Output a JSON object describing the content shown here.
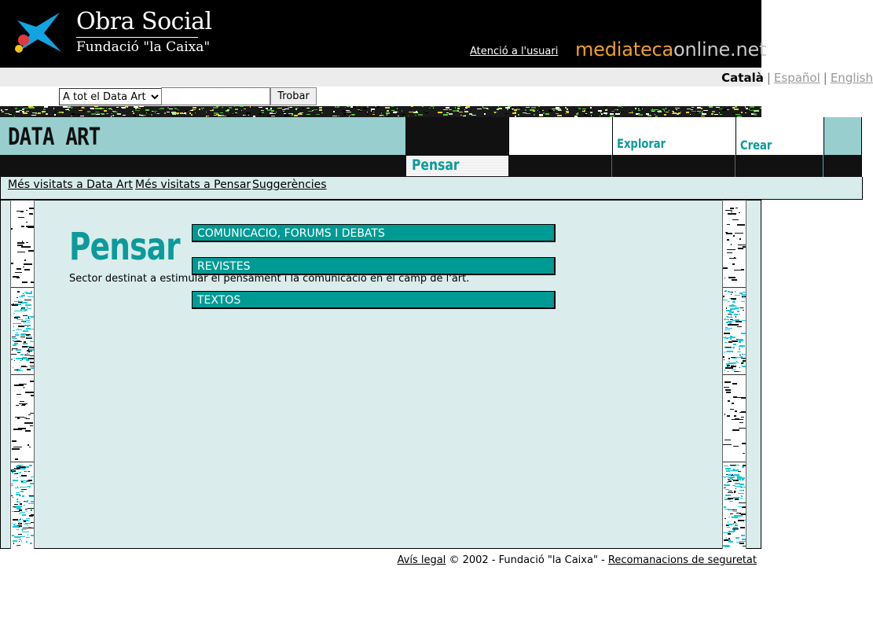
{
  "header": {
    "brand_title": "Obra Social",
    "brand_subtitle": "Fundació \"la Caixa\"",
    "user_link": "Atenció a l'usuari",
    "site_name_part1": "mediateca",
    "site_name_part2": "online.net"
  },
  "languages": {
    "catala": "Català",
    "espanol": "Español",
    "english": "English",
    "separator": "|"
  },
  "search": {
    "scope_selected": "A tot el Data Art",
    "input_value": "",
    "button_label": "Trobar"
  },
  "nav": {
    "section_title": "DATA ART",
    "tabs": [
      {
        "label": "Pensar",
        "active": true
      },
      {
        "label": "Explorar",
        "active": false
      },
      {
        "label": "Crear",
        "active": false
      }
    ]
  },
  "links_bar": {
    "links": [
      "Més visitats a Data Art",
      "Més visitats a Pensar",
      "Suggerències"
    ]
  },
  "main": {
    "heading": "Pensar",
    "description": "Sector destinat a estimular el pensament i la comunicació en el camp de l'art.",
    "sections": [
      "COMUNICACIO, FORUMS I DEBATS",
      "REVISTES",
      "TEXTOS"
    ]
  },
  "footer": {
    "legal_link": "Avís legal",
    "copyright": "© 2002 - Fundació \"la Caixa\" -",
    "security_link": "Recomanacions de seguretat"
  },
  "colors": {
    "teal": "#009a94",
    "teal_text": "#0c9a9a",
    "light_teal_bg": "#daeceb",
    "nav_teal": "#98cece",
    "orange": "#f0a028"
  }
}
